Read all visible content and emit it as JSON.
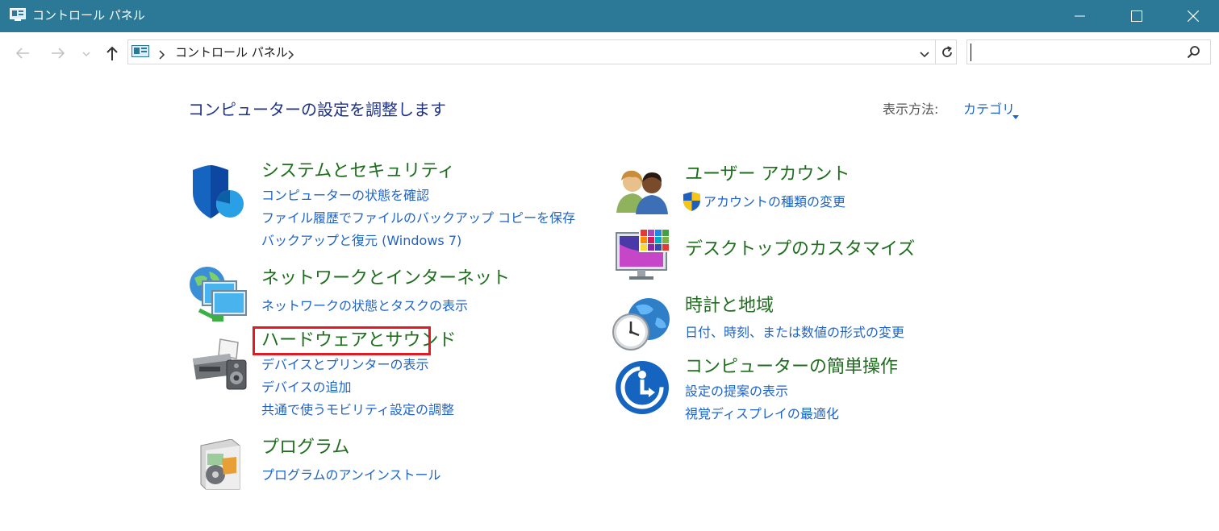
{
  "window": {
    "title": "コントロール パネル"
  },
  "address_bar": {
    "breadcrumb": "コントロール パネル"
  },
  "search": {
    "placeholder": "",
    "value": ""
  },
  "main": {
    "heading": "コンピューターの設定を調整します",
    "view_by_label": "表示方法:",
    "view_by_value": "カテゴリ"
  },
  "categories": {
    "system_security": {
      "title": "システムとセキュリティ",
      "links": [
        "コンピューターの状態を確認",
        "ファイル履歴でファイルのバックアップ コピーを保存",
        "バックアップと復元 (Windows 7)"
      ]
    },
    "network": {
      "title": "ネットワークとインターネット",
      "links": [
        "ネットワークの状態とタスクの表示"
      ]
    },
    "hardware": {
      "title": "ハードウェアとサウンド",
      "links": [
        "デバイスとプリンターの表示",
        "デバイスの追加",
        "共通で使うモビリティ設定の調整"
      ]
    },
    "programs": {
      "title": "プログラム",
      "links": [
        "プログラムのアンインストール"
      ]
    },
    "user_accounts": {
      "title": "ユーザー アカウント",
      "links": [
        "アカウントの種類の変更"
      ]
    },
    "appearance": {
      "title": "デスクトップのカスタマイズ",
      "links": []
    },
    "clock_region": {
      "title": "時計と地域",
      "links": [
        "日付、時刻、または数値の形式の変更"
      ]
    },
    "ease_of_access": {
      "title": "コンピューターの簡単操作",
      "links": [
        "設定の提案の表示",
        "視覚ディスプレイの最適化"
      ]
    }
  },
  "colors": {
    "titlebar": "#2b7996",
    "heading": "#1e3287",
    "category_title": "#1e6e1e",
    "link": "#1e64c8",
    "highlight_box": "#e01b24"
  },
  "icons": {
    "title_icon": "control-panel-icon",
    "back": "back-arrow-icon",
    "forward": "forward-arrow-icon",
    "recent": "chevron-down-icon",
    "up": "up-arrow-icon",
    "refresh": "refresh-icon",
    "search": "search-icon"
  }
}
